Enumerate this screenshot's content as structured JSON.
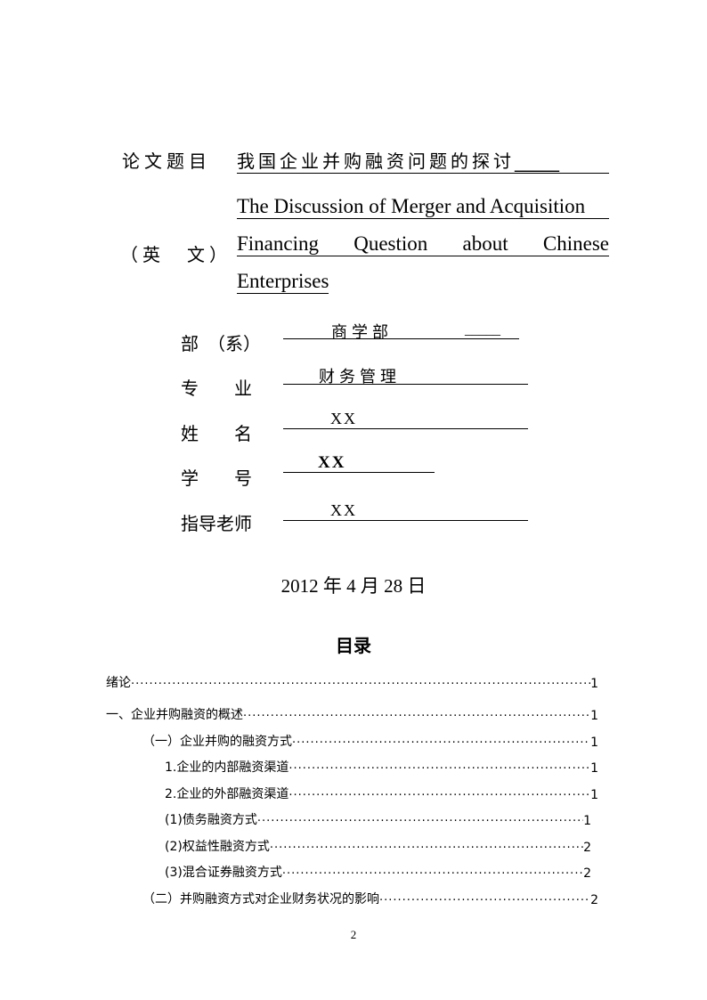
{
  "cover": {
    "title_label": "论文题目",
    "title_cn": "我国企业并购融资问题的探讨",
    "title_cn_suffix": "_____",
    "english_label": "（英　文）",
    "title_en_lines": [
      "The Discussion of Merger and Acquisition",
      "Financing  Question  about  Chinese",
      "Enterprises"
    ],
    "fields": [
      {
        "label": "部　（系）",
        "value": "商学部",
        "suffix": "_____"
      },
      {
        "label": "专　　业",
        "value": "财务管理"
      },
      {
        "label": "姓　　名",
        "value": "XX"
      },
      {
        "label": "学　　号",
        "value": "XX"
      },
      {
        "label": "指导老师",
        "value": "XX"
      }
    ],
    "date": "2012 年 4 月 28 日"
  },
  "toc": {
    "heading": "目录",
    "entries": [
      {
        "text": "绪论",
        "page": "1"
      },
      {
        "text": "一、企业并购融资的概述",
        "page": "1"
      },
      {
        "text": "（一）企业并购的融资方式",
        "page": "1"
      },
      {
        "text": "1.企业的内部融资渠道",
        "page": "1"
      },
      {
        "text": "2.企业的外部融资渠道",
        "page": "1"
      },
      {
        "text": "(1)债务融资方式",
        "page": "1"
      },
      {
        "text": "(2)权益性融资方式",
        "page": "2"
      },
      {
        "text": "(3)混合证券融资方式",
        "page": "2"
      },
      {
        "text": "（二）并购融资方式对企业财务状况的影响",
        "page": "2"
      }
    ]
  },
  "footer": {
    "page_number": "2"
  }
}
